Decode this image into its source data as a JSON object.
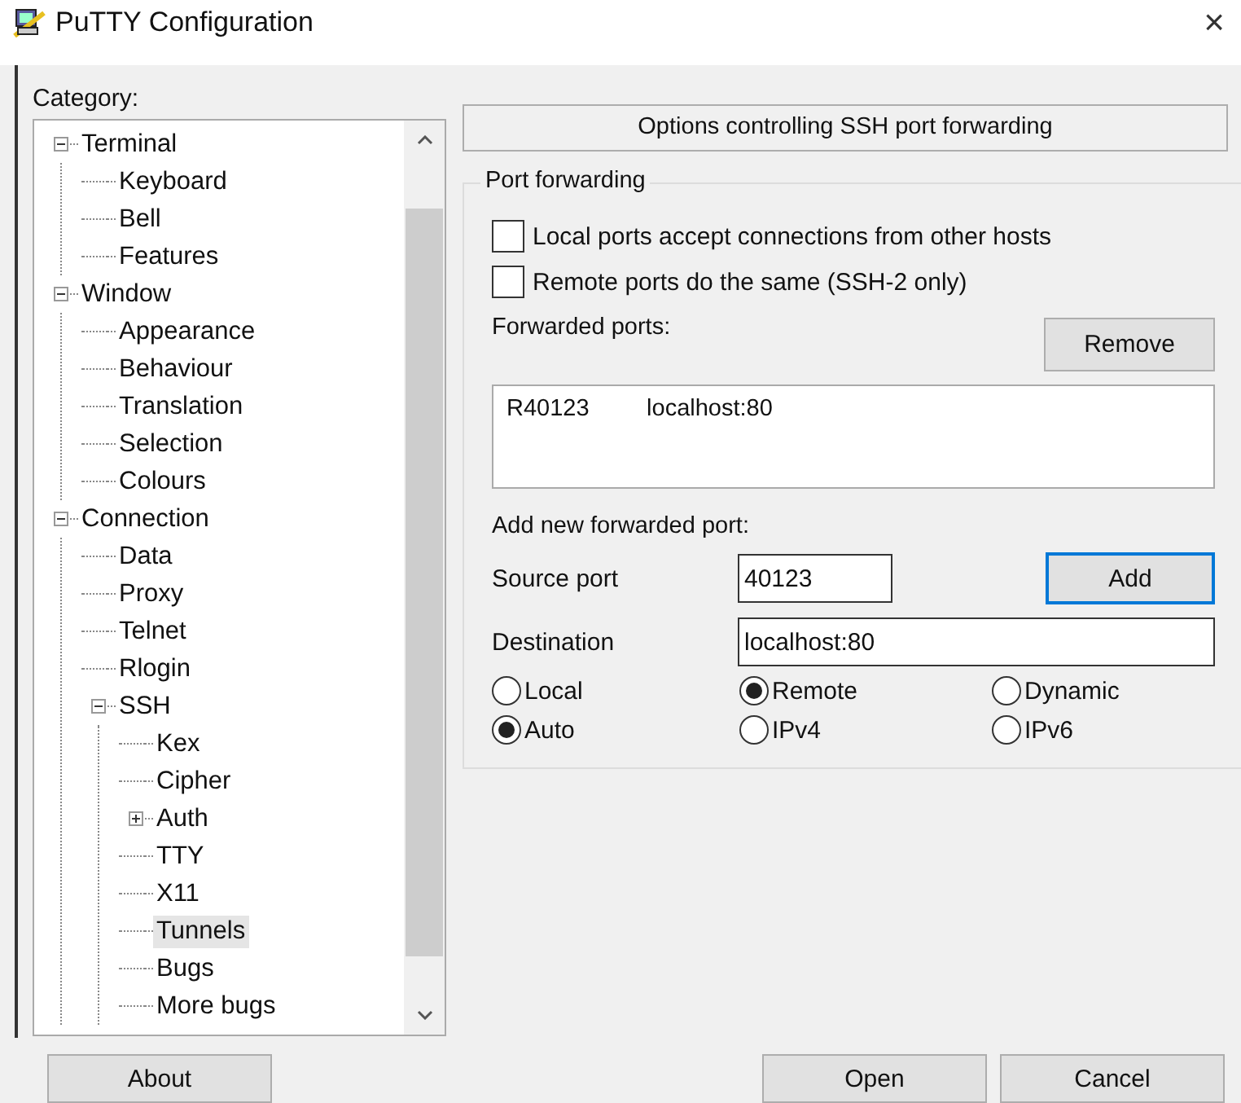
{
  "window": {
    "title": "PuTTY Configuration",
    "close": "×"
  },
  "category_label": "Category:",
  "tree": [
    {
      "label": "Terminal",
      "expanded": true,
      "selected": false,
      "children": [
        {
          "label": "Keyboard",
          "selected": false
        },
        {
          "label": "Bell",
          "selected": false
        },
        {
          "label": "Features",
          "selected": false
        }
      ]
    },
    {
      "label": "Window",
      "expanded": true,
      "selected": false,
      "children": [
        {
          "label": "Appearance",
          "selected": false
        },
        {
          "label": "Behaviour",
          "selected": false
        },
        {
          "label": "Translation",
          "selected": false
        },
        {
          "label": "Selection",
          "selected": false
        },
        {
          "label": "Colours",
          "selected": false
        }
      ]
    },
    {
      "label": "Connection",
      "expanded": true,
      "selected": false,
      "children": [
        {
          "label": "Data",
          "selected": false
        },
        {
          "label": "Proxy",
          "selected": false
        },
        {
          "label": "Telnet",
          "selected": false
        },
        {
          "label": "Rlogin",
          "selected": false
        },
        {
          "label": "SSH",
          "expanded": true,
          "selected": false,
          "children": [
            {
              "label": "Kex",
              "selected": false
            },
            {
              "label": "Cipher",
              "selected": false
            },
            {
              "label": "Auth",
              "expanded": false,
              "selected": false
            },
            {
              "label": "TTY",
              "selected": false
            },
            {
              "label": "X11",
              "selected": false
            },
            {
              "label": "Tunnels",
              "selected": true
            },
            {
              "label": "Bugs",
              "selected": false
            },
            {
              "label": "More bugs",
              "selected": false
            }
          ]
        }
      ]
    }
  ],
  "panel_header": "Options controlling SSH port forwarding",
  "group_title": "Port forwarding",
  "checkboxes": [
    {
      "label": "Local ports accept connections from other hosts",
      "checked": false
    },
    {
      "label": "Remote ports do the same (SSH-2 only)",
      "checked": false
    }
  ],
  "forwarded_ports_label": "Forwarded ports:",
  "remove_button": "Remove",
  "forwarded_ports": [
    {
      "source": "R40123",
      "destination": "localhost:80"
    }
  ],
  "add_label": "Add new forwarded port:",
  "source_port": {
    "label": "Source port",
    "value": "40123"
  },
  "add_button": "Add",
  "destination": {
    "label": "Destination",
    "value": "localhost:80"
  },
  "direction_options": [
    {
      "label": "Local",
      "selected": false
    },
    {
      "label": "Remote",
      "selected": true
    },
    {
      "label": "Dynamic",
      "selected": false
    }
  ],
  "ip_options": [
    {
      "label": "Auto",
      "selected": true
    },
    {
      "label": "IPv4",
      "selected": false
    },
    {
      "label": "IPv6",
      "selected": false
    }
  ],
  "buttons": {
    "about": "About",
    "open": "Open",
    "cancel": "Cancel"
  }
}
